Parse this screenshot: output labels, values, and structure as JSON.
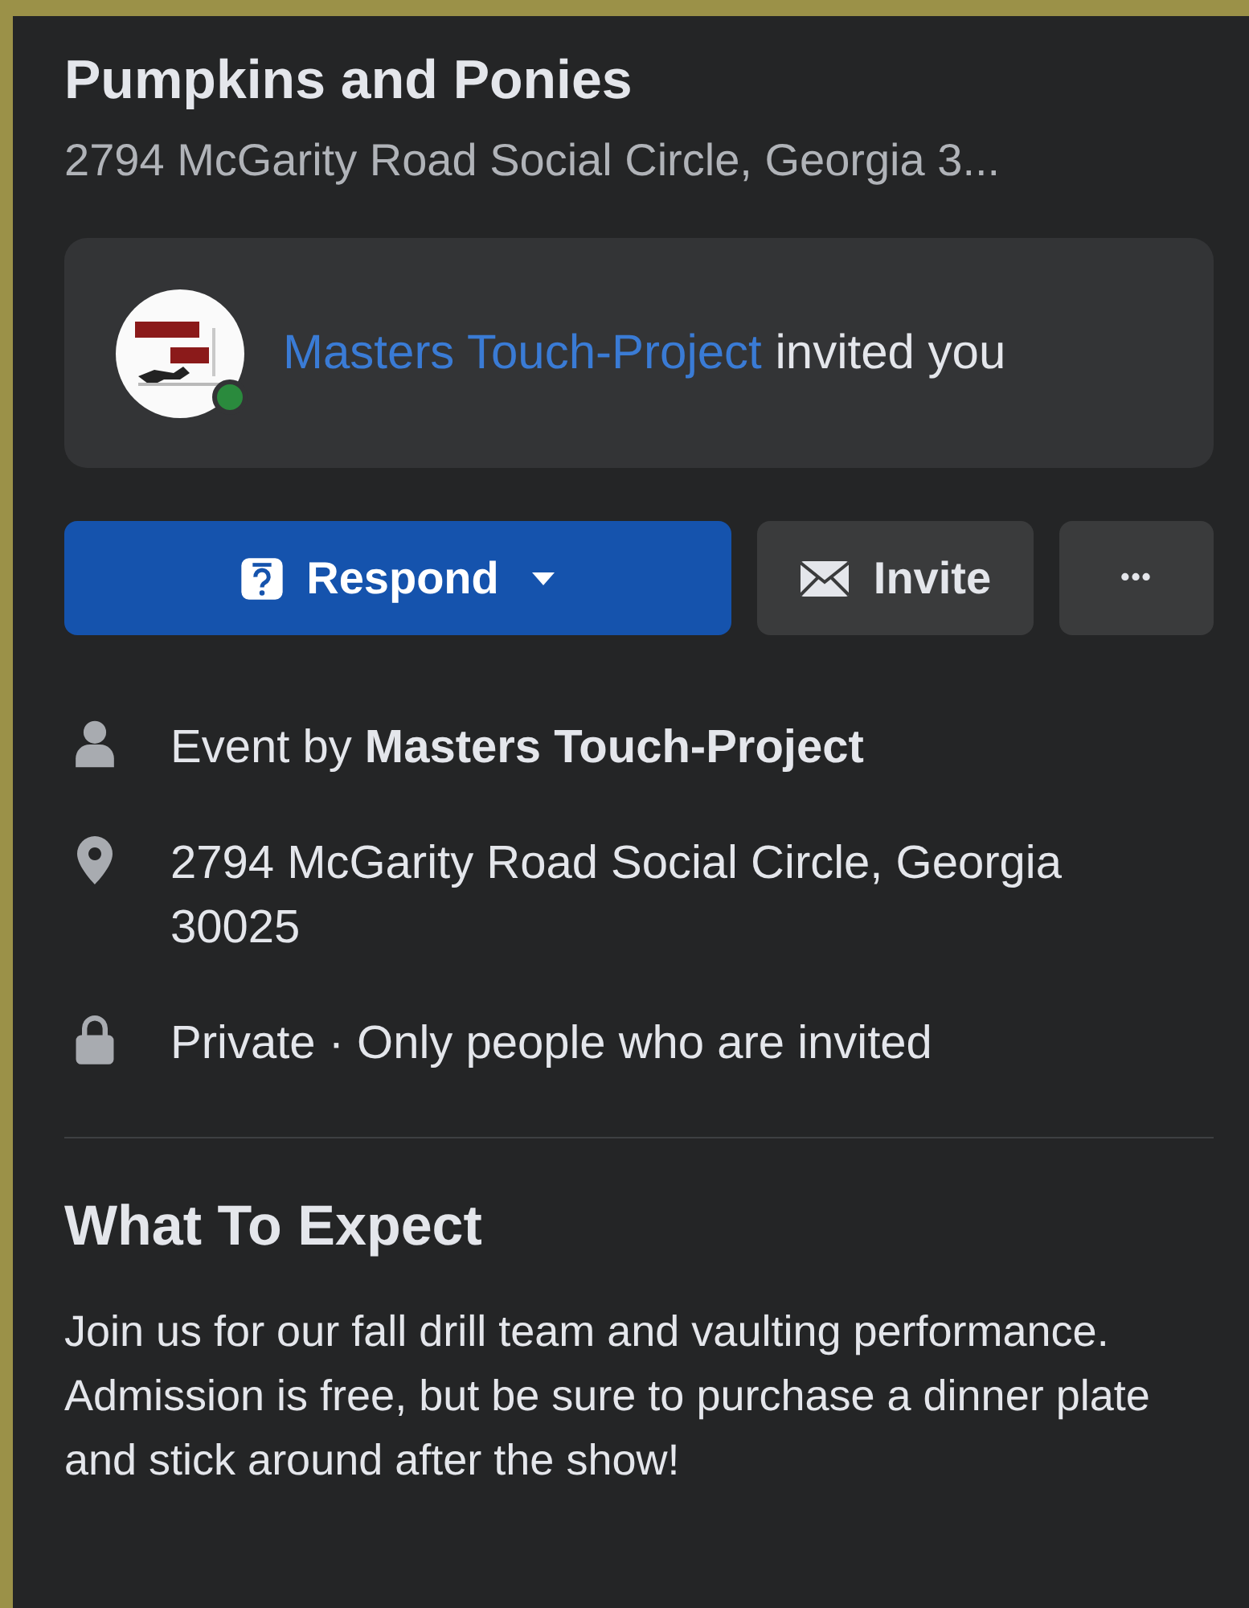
{
  "event": {
    "title": "Pumpkins and Ponies",
    "address": "2794 McGarity Road Social Circle, Georgia 3..."
  },
  "invite": {
    "host": "Masters Touch-Project",
    "text": "invited you",
    "online": true
  },
  "buttons": [
    {
      "kind": "respond",
      "label": "Respond"
    },
    {
      "kind": "invite",
      "label": "Invite"
    },
    {
      "kind": "more",
      "label": "•••"
    }
  ],
  "details": [
    {
      "kind": "person",
      "text": "Event by **Masters Touch-Project**"
    },
    {
      "kind": "location",
      "text": "2794 McGarity Road Social Circle, Georgia 30025"
    },
    {
      "kind": "lock",
      "text": "Private · Only people who are invited"
    }
  ],
  "about": {
    "heading": "What To Expect",
    "text": "Join us for our fall drill team and vaulting performance. Admission is free, but be sure to purchase a dinner plate and stick around after the show!"
  }
}
